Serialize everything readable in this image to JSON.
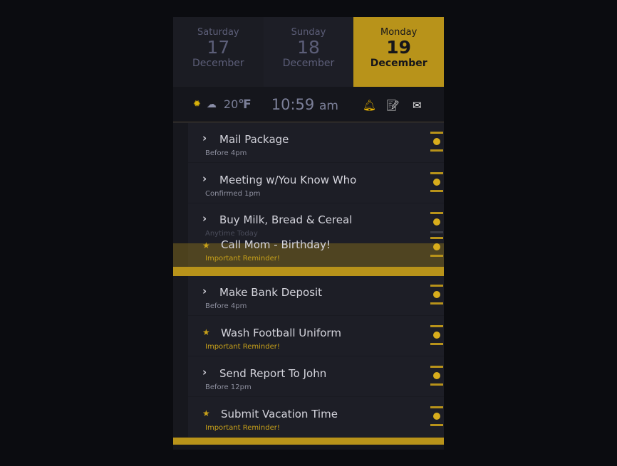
{
  "days": [
    {
      "name": "Saturday",
      "date": "17",
      "month": "December",
      "active": false
    },
    {
      "name": "Sunday",
      "date": "18",
      "month": "December",
      "active": false
    },
    {
      "name": "Monday",
      "date": "19",
      "month": "December",
      "active": true
    }
  ],
  "status": {
    "weather_icon": "sun-icon",
    "cloud_icon": "cloud-icon",
    "temp": "20",
    "unit": "℉",
    "time": "10:59",
    "ampm": "am",
    "icons": [
      "bell-icon",
      "memo-icon",
      "inbox-icon"
    ]
  },
  "items": [
    {
      "title": "Mail Package",
      "sub": "Before 4pm",
      "type": "normal"
    },
    {
      "title": "Meeting w/You Know Who",
      "sub": "Confirmed 1pm",
      "type": "normal"
    },
    {
      "title": "Buy Milk, Bread & Cereal",
      "sub": "Anytime Today",
      "type": "normal"
    },
    {
      "title": "Call Mom - Birthday!",
      "sub": "Important Reminder!",
      "type": "important"
    },
    {
      "title": "Make Bank Deposit",
      "sub": "Before 4pm",
      "type": "normal"
    },
    {
      "title": "Wash Football Uniform",
      "sub": "Important Reminder!",
      "type": "important"
    },
    {
      "title": "Send Report To John",
      "sub": "Before 12pm",
      "type": "normal"
    },
    {
      "title": "Submit Vacation Time",
      "sub": "Important Reminder!",
      "type": "important"
    }
  ],
  "colors": {
    "accent": "#b8931a",
    "background": "#0b0c10",
    "panel": "#1d1e26"
  }
}
